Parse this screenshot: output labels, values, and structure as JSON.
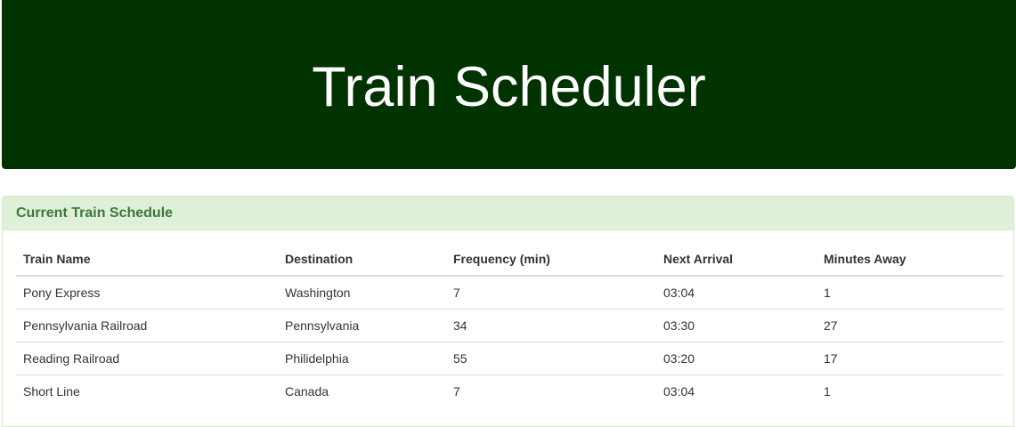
{
  "header": {
    "title": "Train Scheduler"
  },
  "schedule": {
    "title": "Current Train Schedule",
    "columns": [
      "Train Name",
      "Destination",
      "Frequency (min)",
      "Next Arrival",
      "Minutes Away"
    ],
    "rows": [
      [
        "Pony Express",
        "Washington",
        "7",
        "03:04",
        "1"
      ],
      [
        "Pennsylvania Railroad",
        "Pennsylvania",
        "34",
        "03:30",
        "27"
      ],
      [
        "Reading Railroad",
        "Philidelphia",
        "55",
        "03:20",
        "17"
      ],
      [
        "Short Line",
        "Canada",
        "7",
        "03:04",
        "1"
      ]
    ]
  },
  "colors": {
    "header_bg": "#003300",
    "panel_heading_bg": "#dff0d8",
    "panel_heading_text": "#3c763d"
  }
}
